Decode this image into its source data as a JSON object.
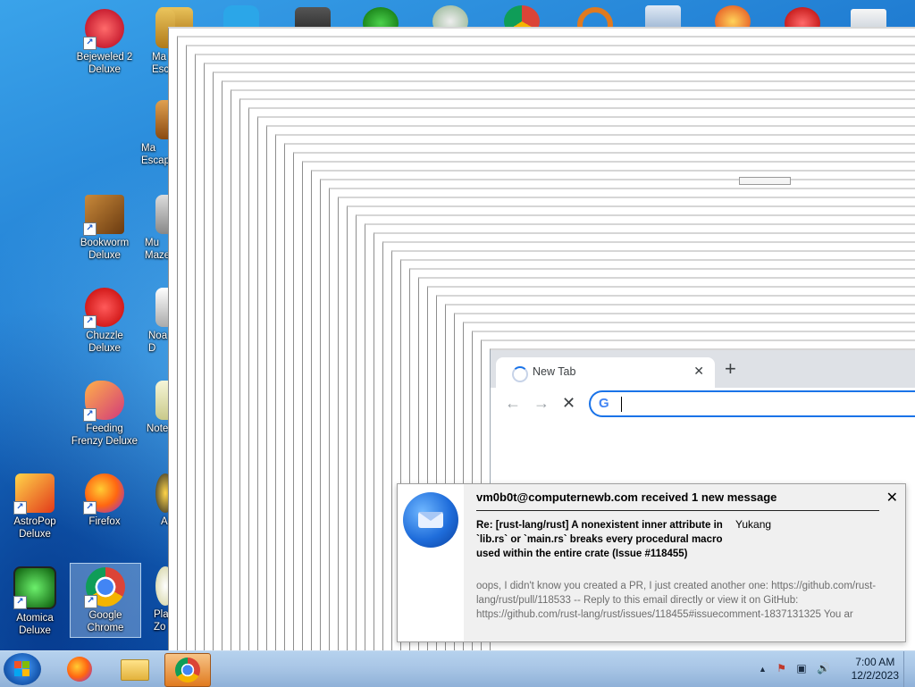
{
  "desktop": {
    "icons": [
      {
        "label": "Bejeweled 2\nDeluxe"
      },
      {
        "label": "Bookworm\nDeluxe"
      },
      {
        "label": "Chuzzle\nDeluxe"
      },
      {
        "label": "Feeding\nFrenzy Deluxe"
      },
      {
        "label": "AstroPop\nDeluxe"
      },
      {
        "label": "Firefox"
      },
      {
        "label": "Atomica\nDeluxe"
      },
      {
        "label": "Google\nChrome"
      },
      {
        "label": "Ma\nEsc"
      },
      {
        "label": "Ma\nEscap"
      },
      {
        "label": "Mu\nMaze"
      },
      {
        "label": "Noa\nD"
      },
      {
        "label": "Note"
      },
      {
        "label": "A"
      },
      {
        "label": "Pla\nZo"
      }
    ]
  },
  "chrome": {
    "tab_title": "New Tab",
    "close_tab": "✕",
    "new_tab": "+",
    "back": "←",
    "forward": "→",
    "stop": "✕",
    "google_g": "G"
  },
  "notification": {
    "header": "vm0b0t@computernewb.com received 1 new message",
    "close": "✕",
    "subject": "Re: [rust-lang/rust] A nonexistent inner attribute in `lib.rs` or `main.rs` breaks every procedural macro used within the entire crate (Issue #118455)",
    "from": "Yukang",
    "preview": "oops, I didn't know you created a PR, I just created another one: https://github.com/rust-lang/rust/pull/118533 -- Reply to this email directly or view it on GitHub: https://github.com/rust-lang/rust/issues/118455#issuecomment-1837131325 You ar"
  },
  "taskbar": {
    "tray_arrow": "▲",
    "tray_flag": "⚑",
    "tray_network": "▣",
    "tray_volume": "🔊",
    "time": "7:00 AM",
    "date": "12/2/2023"
  },
  "colors": {
    "accent": "#1a73e8",
    "taskbar": "#a9c6e6"
  }
}
